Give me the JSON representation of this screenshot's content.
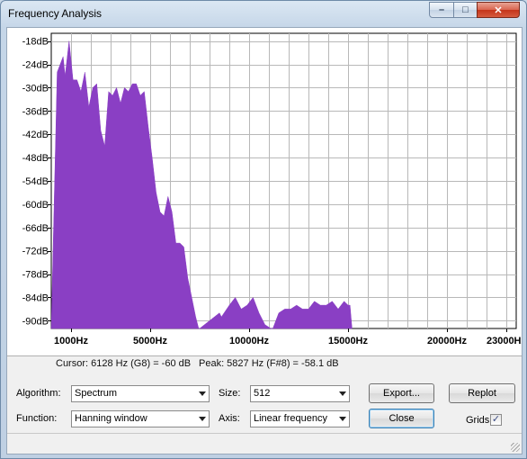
{
  "window": {
    "title": "Frequency Analysis",
    "minimize_glyph": "–",
    "maximize_glyph": "□",
    "close_glyph": "✕"
  },
  "plot": {
    "y_ticks": [
      {
        "label": "-18dB",
        "db": -18
      },
      {
        "label": "-24dB",
        "db": -24
      },
      {
        "label": "-30dB",
        "db": -30
      },
      {
        "label": "-36dB",
        "db": -36
      },
      {
        "label": "-42dB",
        "db": -42
      },
      {
        "label": "-48dB",
        "db": -48
      },
      {
        "label": "-54dB",
        "db": -54
      },
      {
        "label": "-60dB",
        "db": -60
      },
      {
        "label": "-66dB",
        "db": -66
      },
      {
        "label": "-72dB",
        "db": -72
      },
      {
        "label": "-78dB",
        "db": -78
      },
      {
        "label": "-84dB",
        "db": -84
      },
      {
        "label": "-90dB",
        "db": -90
      }
    ],
    "x_ticks": [
      {
        "label": "1000Hz",
        "hz": 1000
      },
      {
        "label": "5000Hz",
        "hz": 5000
      },
      {
        "label": "10000Hz",
        "hz": 10000
      },
      {
        "label": "15000Hz",
        "hz": 15000
      },
      {
        "label": "20000Hz",
        "hz": 20000
      },
      {
        "label": "23000Hz",
        "hz": 23000
      }
    ],
    "fill_color": "#8a3fc4",
    "grid": true
  },
  "chart_data": {
    "type": "area",
    "x_unit": "Hz",
    "y_unit": "dB",
    "xlim": [
      0,
      23500
    ],
    "ylim": [
      -92,
      -16
    ],
    "x": [
      0,
      300,
      600,
      700,
      900,
      1100,
      1300,
      1500,
      1700,
      1900,
      2100,
      2300,
      2500,
      2700,
      2900,
      3100,
      3300,
      3500,
      3700,
      3900,
      4100,
      4300,
      4500,
      4700,
      4900,
      5100,
      5300,
      5500,
      5700,
      5900,
      6100,
      6300,
      6500,
      6700,
      6900,
      7100,
      7300,
      7450,
      7500,
      8500,
      8600,
      9000,
      9300,
      9600,
      9900,
      10200,
      10500,
      10800,
      11100,
      11200,
      11500,
      11800,
      12100,
      12400,
      12700,
      13000,
      13300,
      13600,
      13900,
      14200,
      14500,
      14800,
      15000,
      15100,
      15200
    ],
    "values": [
      -92,
      -26,
      -22,
      -27,
      -18,
      -28,
      -28,
      -31,
      -26,
      -35,
      -30,
      -29,
      -41,
      -45,
      -31,
      -32,
      -30,
      -34,
      -30,
      -31,
      -29,
      -29,
      -32,
      -31,
      -40,
      -48,
      -57,
      -62,
      -63,
      -58,
      -62,
      -70,
      -70,
      -71,
      -79,
      -84,
      -89,
      -92,
      -92,
      -88,
      -89,
      -86,
      -84,
      -87,
      -86,
      -84,
      -88,
      -91,
      -92,
      -92,
      -88,
      -87,
      -87,
      -86,
      -87,
      -87,
      -85,
      -86,
      -86,
      -85,
      -87,
      -85,
      -86,
      -86,
      -92
    ]
  },
  "readout": {
    "cursor": "Cursor: 6128 Hz (G8) = -60 dB",
    "peak": "Peak: 5827 Hz (F#8) = -58.1 dB"
  },
  "controls": {
    "algorithm_label": "Algorithm:",
    "algorithm_value": "Spectrum",
    "size_label": "Size:",
    "size_value": "512",
    "function_label": "Function:",
    "function_value": "Hanning window",
    "axis_label": "Axis:",
    "axis_value": "Linear frequency",
    "export_label": "Export...",
    "replot_label": "Replot",
    "close_label": "Close",
    "grids_label": "Grids",
    "grids_checked": "✓"
  }
}
